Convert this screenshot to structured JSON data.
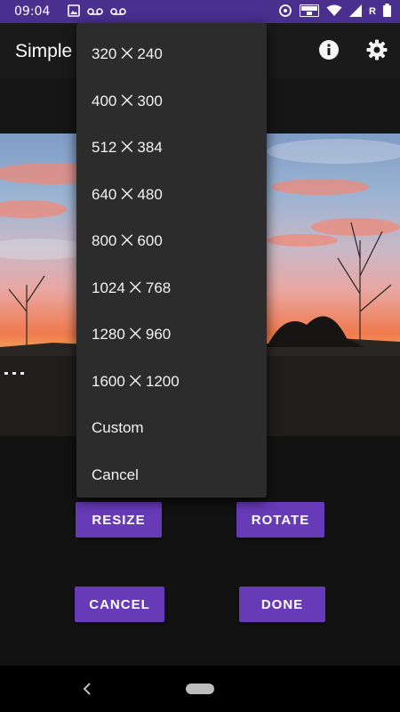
{
  "status_bar": {
    "time": "09:04",
    "carrier_label": "R"
  },
  "app_bar": {
    "title": "Simple",
    "info_icon": "info-icon",
    "settings_icon": "gear-icon"
  },
  "buttons": {
    "resize": "RESIZE",
    "rotate": "ROTATE",
    "cancel": "CANCEL",
    "done": "DONE"
  },
  "resize_menu": {
    "items": [
      "320 ⨉ 240",
      "400 ⨉ 300",
      "512 ⨉ 384",
      "640 ⨉ 480",
      "800 ⨉ 600",
      "1024 ⨉ 768",
      "1280 ⨉ 960",
      "1600 ⨉ 1200",
      "Custom",
      "Cancel"
    ]
  },
  "colors": {
    "accent": "#673ab7",
    "status_bar": "#4a2f8f",
    "menu_bg": "#2c2c2c"
  }
}
